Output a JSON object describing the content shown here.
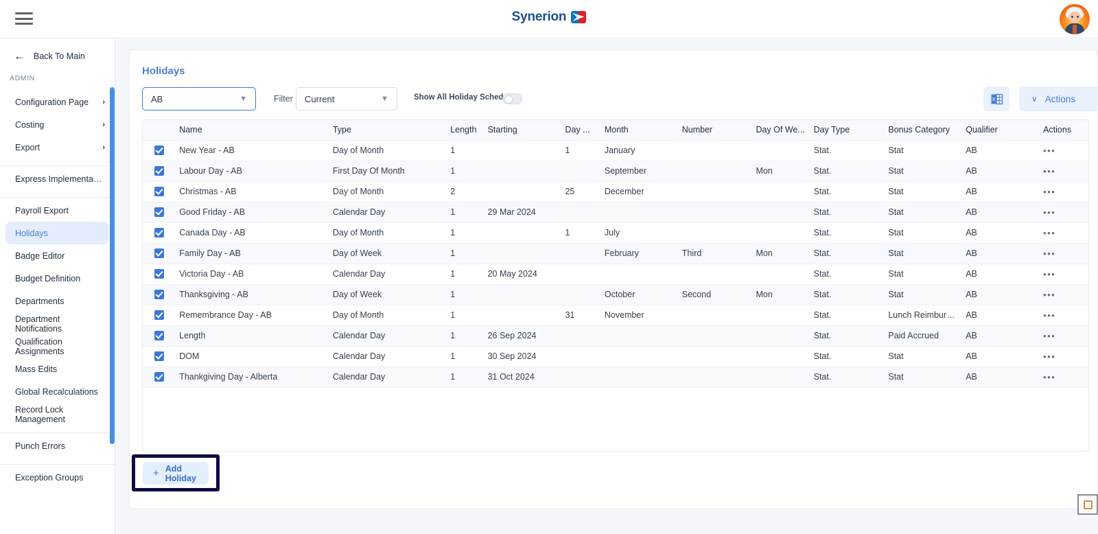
{
  "header": {
    "menu_icon": "hamburger-icon",
    "brand": "Synerion",
    "avatar_icon": "user-avatar"
  },
  "sidebar": {
    "back_label": "Back To Main",
    "back_icon": "arrow-left-icon",
    "section_label": "ADMIN",
    "groups": [
      {
        "items": [
          {
            "label": "Configuration Page",
            "chevron": "›",
            "active": false
          },
          {
            "label": "Costing",
            "chevron": "›",
            "active": false
          },
          {
            "label": "Export",
            "chevron": "›",
            "active": false
          }
        ]
      },
      {
        "items": [
          {
            "label": "Express Implementation P...",
            "chevron": "",
            "active": false
          }
        ]
      },
      {
        "items": [
          {
            "label": "Payroll Export",
            "chevron": "",
            "active": false
          },
          {
            "label": "Holidays",
            "chevron": "",
            "active": true
          },
          {
            "label": "Badge Editor",
            "chevron": "",
            "active": false
          },
          {
            "label": "Budget Definition",
            "chevron": "",
            "active": false
          },
          {
            "label": "Departments",
            "chevron": "",
            "active": false
          },
          {
            "label": "Department Notifications",
            "chevron": "",
            "active": false
          },
          {
            "label": "Qualification Assignments",
            "chevron": "",
            "active": false
          },
          {
            "label": "Mass Edits",
            "chevron": "",
            "active": false
          },
          {
            "label": "Global Recalculations",
            "chevron": "",
            "active": false
          },
          {
            "label": "Record Lock Management",
            "chevron": "",
            "active": false
          }
        ]
      },
      {
        "items": [
          {
            "label": "Punch Errors",
            "chevron": "",
            "active": false
          }
        ]
      },
      {
        "items": [
          {
            "label": "Exception Groups",
            "chevron": "",
            "active": false
          }
        ]
      }
    ]
  },
  "page": {
    "title": "Holidays"
  },
  "toolbar": {
    "schedule_select_value": "AB",
    "filter_label": "Filter",
    "filter_select_value": "Current",
    "toggle_label": "Show All Holiday Schedules",
    "toggle_on": false,
    "excel_icon": "excel-export-icon",
    "actions_label": "Actions",
    "actions_chevron": "∨"
  },
  "table": {
    "columns": [
      "",
      "Name",
      "Type",
      "Length",
      "Starting",
      "Day ...",
      "Month",
      "Number",
      "Day Of We...",
      "Day Type",
      "Bonus Category",
      "Qualifier",
      "Actions"
    ],
    "rows": [
      {
        "checked": true,
        "name": "New Year - AB",
        "type": "Day of Month",
        "length": "1",
        "starting": "",
        "day": "1",
        "month": "January",
        "number": "",
        "day_of_week": "",
        "day_type": "Stat.",
        "bonus_category": "Stat",
        "qualifier": "AB",
        "actions": "•••"
      },
      {
        "checked": true,
        "name": "Labour Day - AB",
        "type": "First Day Of Month",
        "length": "1",
        "starting": "",
        "day": "",
        "month": "September",
        "number": "",
        "day_of_week": "Mon",
        "day_type": "Stat.",
        "bonus_category": "Stat",
        "qualifier": "AB",
        "actions": "•••"
      },
      {
        "checked": true,
        "name": "Christmas - AB",
        "type": "Day of Month",
        "length": "2",
        "starting": "",
        "day": "25",
        "month": "December",
        "number": "",
        "day_of_week": "",
        "day_type": "Stat.",
        "bonus_category": "Stat",
        "qualifier": "AB",
        "actions": "•••"
      },
      {
        "checked": true,
        "name": "Good Friday - AB",
        "type": "Calendar Day",
        "length": "1",
        "starting": "29 Mar 2024",
        "day": "",
        "month": "",
        "number": "",
        "day_of_week": "",
        "day_type": "Stat.",
        "bonus_category": "Stat",
        "qualifier": "AB",
        "actions": "•••"
      },
      {
        "checked": true,
        "name": "Canada Day - AB",
        "type": "Day of Month",
        "length": "1",
        "starting": "",
        "day": "1",
        "month": "July",
        "number": "",
        "day_of_week": "",
        "day_type": "Stat.",
        "bonus_category": "Stat",
        "qualifier": "AB",
        "actions": "•••"
      },
      {
        "checked": true,
        "name": "Family Day - AB",
        "type": "Day of Week",
        "length": "1",
        "starting": "",
        "day": "",
        "month": "February",
        "number": "Third",
        "day_of_week": "Mon",
        "day_type": "Stat.",
        "bonus_category": "Stat",
        "qualifier": "AB",
        "actions": "•••"
      },
      {
        "checked": true,
        "name": "Victoria Day - AB",
        "type": "Calendar Day",
        "length": "1",
        "starting": "20 May 2024",
        "day": "",
        "month": "",
        "number": "",
        "day_of_week": "",
        "day_type": "Stat.",
        "bonus_category": "Stat",
        "qualifier": "AB",
        "actions": "•••"
      },
      {
        "checked": true,
        "name": "Thanksgiving - AB",
        "type": "Day of Week",
        "length": "1",
        "starting": "",
        "day": "",
        "month": "October",
        "number": "Second",
        "day_of_week": "Mon",
        "day_type": "Stat.",
        "bonus_category": "Stat",
        "qualifier": "AB",
        "actions": "•••"
      },
      {
        "checked": true,
        "name": "Remembrance Day - AB",
        "type": "Day of Month",
        "length": "1",
        "starting": "",
        "day": "31",
        "month": "November",
        "number": "",
        "day_of_week": "",
        "day_type": "Stat.",
        "bonus_category": "Lunch Reimburs...",
        "qualifier": "AB",
        "actions": "•••"
      },
      {
        "checked": true,
        "name": "Length",
        "type": "Calendar Day",
        "length": "1",
        "starting": "26 Sep 2024",
        "day": "",
        "month": "",
        "number": "",
        "day_of_week": "",
        "day_type": "Stat.",
        "bonus_category": "Paid Accrued",
        "qualifier": "AB",
        "actions": "•••"
      },
      {
        "checked": true,
        "name": "DOM",
        "type": "Calendar Day",
        "length": "1",
        "starting": "30 Sep 2024",
        "day": "",
        "month": "",
        "number": "",
        "day_of_week": "",
        "day_type": "Stat.",
        "bonus_category": "Stat",
        "qualifier": "AB",
        "actions": "•••"
      },
      {
        "checked": true,
        "name": "Thankgiving Day - Alberta",
        "type": "Calendar Day",
        "length": "1",
        "starting": "31 Oct 2024",
        "day": "",
        "month": "",
        "number": "",
        "day_of_week": "",
        "day_type": "Stat.",
        "bonus_category": "Stat",
        "qualifier": "AB",
        "actions": "•••"
      }
    ]
  },
  "footer": {
    "add_label": "Add Holiday",
    "add_plus": "+"
  },
  "colors": {
    "accent": "#4a7fd4",
    "checkbox": "#3b78d8",
    "highlight_box": "#0d0d46",
    "row_stripe": "#f7f9fc",
    "content_bg": "#f4f7fb"
  }
}
